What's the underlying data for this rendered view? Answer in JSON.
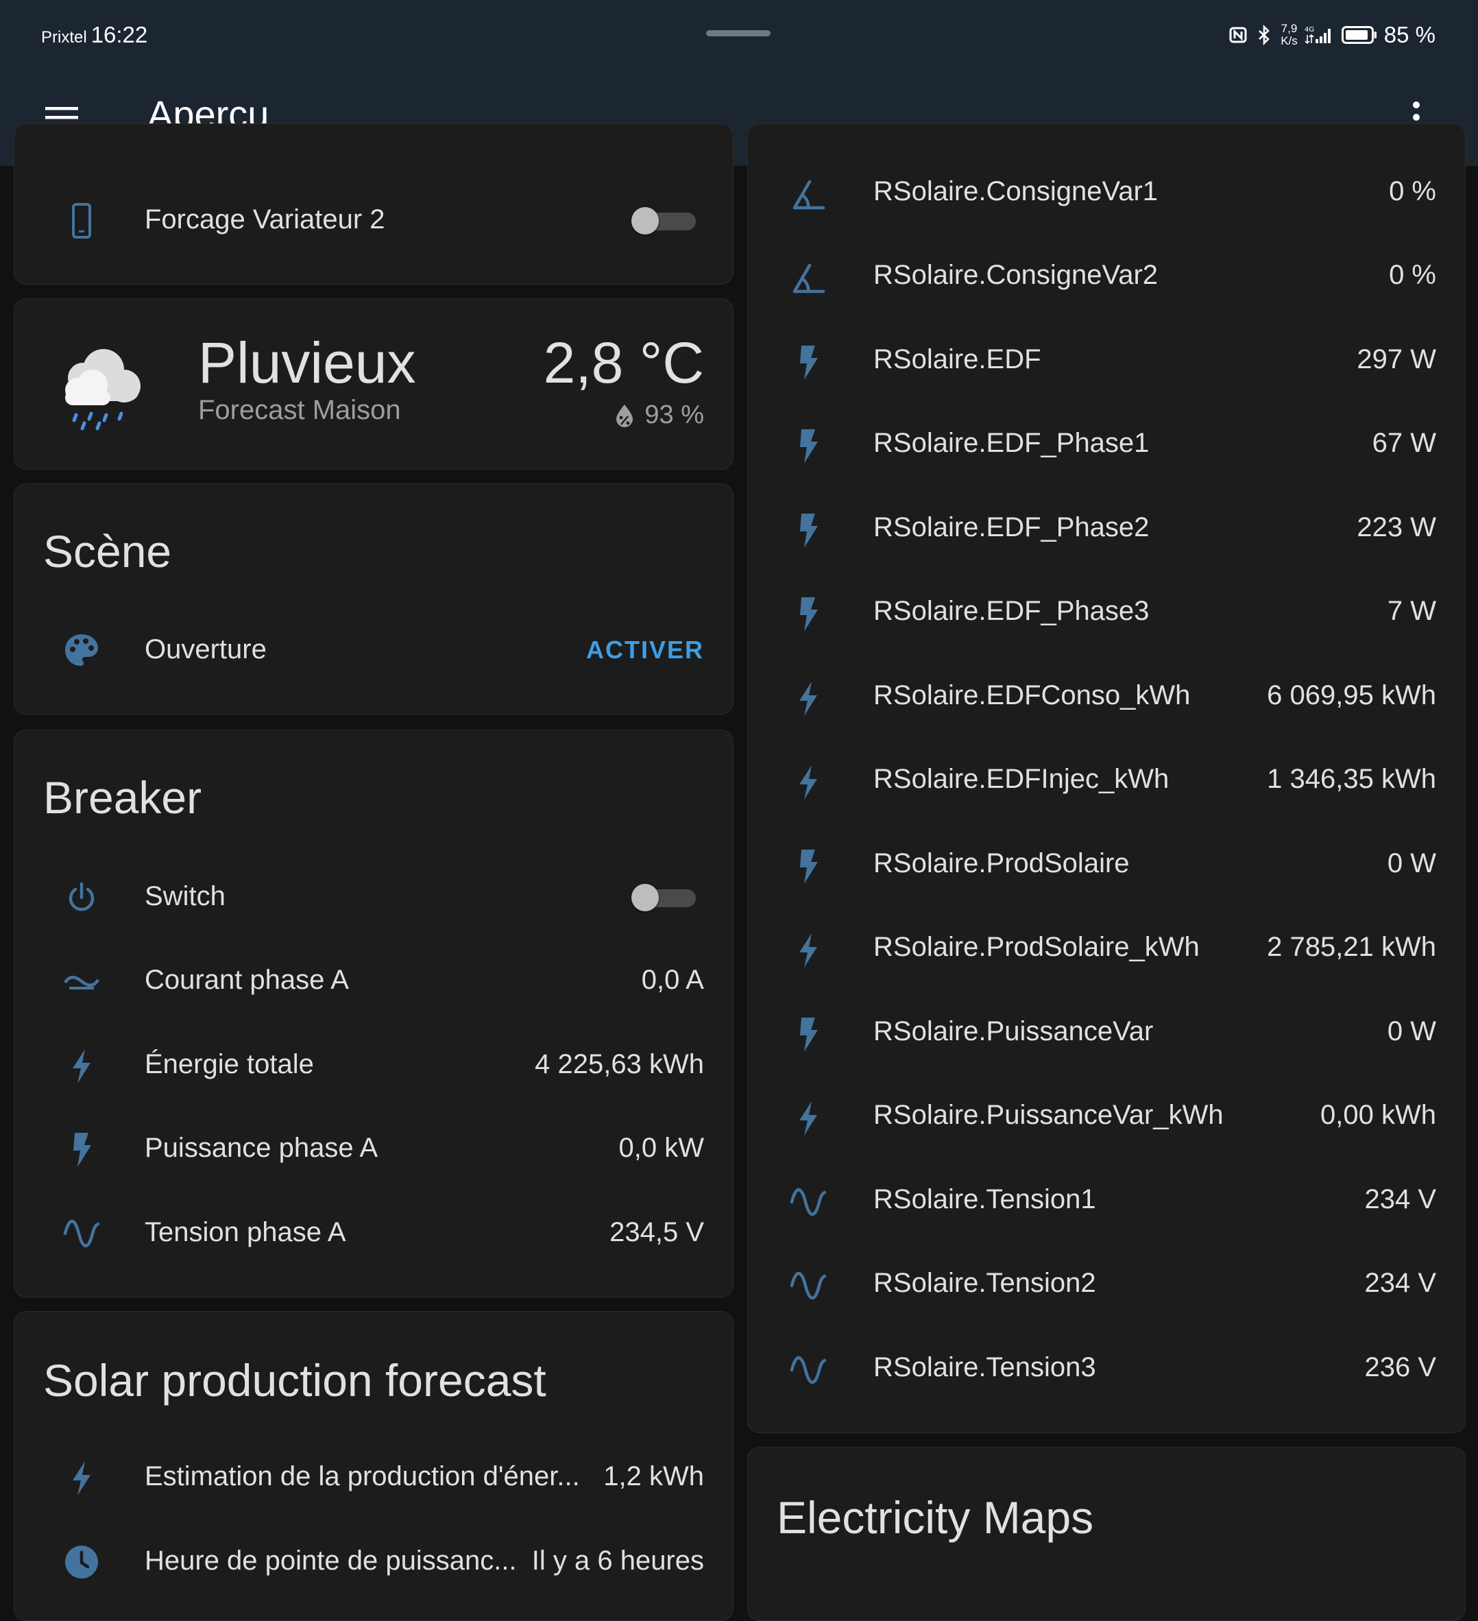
{
  "status_bar": {
    "carrier": "Prixtel",
    "time": "16:22",
    "net_speed_value": "7,9",
    "net_speed_unit": "K/s",
    "battery": "85 %"
  },
  "app_bar": {
    "title": "Aperçu"
  },
  "forcage_card": {
    "label": "Forcage Variateur 2"
  },
  "weather_card": {
    "condition": "Pluvieux",
    "name": "Forecast Maison",
    "temperature": "2,8 °C",
    "humidity": "93 %"
  },
  "scene_card": {
    "title": "Scène",
    "item_label": "Ouverture",
    "action": "ACTIVER"
  },
  "breaker_card": {
    "title": "Breaker",
    "switch_label": "Switch",
    "rows": [
      {
        "label": "Courant phase A",
        "value": "0,0 A"
      },
      {
        "label": "Énergie totale",
        "value": "4 225,63 kWh"
      },
      {
        "label": "Puissance phase A",
        "value": "0,0 kW"
      },
      {
        "label": "Tension phase A",
        "value": "234,5 V"
      }
    ]
  },
  "solar_card": {
    "title": "Solar production forecast",
    "rows": [
      {
        "label": "Estimation de la production d'éner...",
        "value": "1,2 kWh"
      },
      {
        "label": "Heure de pointe de puissanc...",
        "value": "Il y a 6 heures"
      }
    ]
  },
  "rsolaire_card": {
    "rows": [
      {
        "label": "RSolaire.ConsigneVar1",
        "value": "0 %"
      },
      {
        "label": "RSolaire.ConsigneVar2",
        "value": "0 %"
      },
      {
        "label": "RSolaire.EDF",
        "value": "297 W"
      },
      {
        "label": "RSolaire.EDF_Phase1",
        "value": "67 W"
      },
      {
        "label": "RSolaire.EDF_Phase2",
        "value": "223 W"
      },
      {
        "label": "RSolaire.EDF_Phase3",
        "value": "7 W"
      },
      {
        "label": "RSolaire.EDFConso_kWh",
        "value": "6 069,95 kWh"
      },
      {
        "label": "RSolaire.EDFInjec_kWh",
        "value": "1 346,35 kWh"
      },
      {
        "label": "RSolaire.ProdSolaire",
        "value": "0 W"
      },
      {
        "label": "RSolaire.ProdSolaire_kWh",
        "value": "2 785,21 kWh"
      },
      {
        "label": "RSolaire.PuissanceVar",
        "value": "0 W"
      },
      {
        "label": "RSolaire.PuissanceVar_kWh",
        "value": "0,00 kWh"
      },
      {
        "label": "RSolaire.Tension1",
        "value": "234 V"
      },
      {
        "label": "RSolaire.Tension2",
        "value": "234 V"
      },
      {
        "label": "RSolaire.Tension3",
        "value": "236 V"
      }
    ]
  },
  "electricity_card": {
    "title": "Electricity Maps"
  },
  "colors": {
    "bar_background": "#1c2631",
    "card_background": "#1c1c1c",
    "page_background": "#111111",
    "icon_blue": "#44739e",
    "accent_blue": "#3d9ee6"
  }
}
